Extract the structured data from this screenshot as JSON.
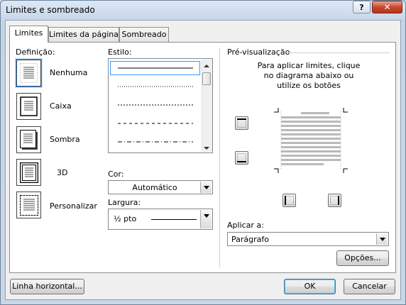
{
  "window": {
    "title": "Limites e sombreado",
    "help_label": "?",
    "close_label": "✕"
  },
  "tabs": [
    {
      "label": "Limites"
    },
    {
      "label": "Limites da página"
    },
    {
      "label": "Sombreado"
    }
  ],
  "setting": {
    "heading": "Definição:",
    "presets": [
      {
        "label": "Nenhuma",
        "icon": "border-none-icon"
      },
      {
        "label": "Caixa",
        "icon": "border-box-icon"
      },
      {
        "label": "Sombra",
        "icon": "border-shadow-icon"
      },
      {
        "label": "3D",
        "icon": "border-3d-icon"
      },
      {
        "label": "Personalizar",
        "icon": "border-custom-icon"
      }
    ],
    "selected": "Nenhuma"
  },
  "style": {
    "heading": "Estilo:",
    "line_styles": [
      "solid",
      "dotted",
      "dashed-small",
      "dashed",
      "dash-dot"
    ]
  },
  "color": {
    "label": "Cor:",
    "value": "Automático"
  },
  "width": {
    "label": "Largura:",
    "value": "½ pto"
  },
  "preview": {
    "heading": "Pré-visualização",
    "instructions": "Para aplicar limites, clique no diagrama abaixo ou utilize os botões"
  },
  "apply_to": {
    "label": "Aplicar a:",
    "value": "Parágrafo"
  },
  "buttons": {
    "options": "Opções...",
    "horizontal_line": "Linha horizontal...",
    "ok": "OK",
    "cancel": "Cancelar"
  },
  "colors": {
    "accent": "#3399ff",
    "frame": "#c9d6e3"
  }
}
